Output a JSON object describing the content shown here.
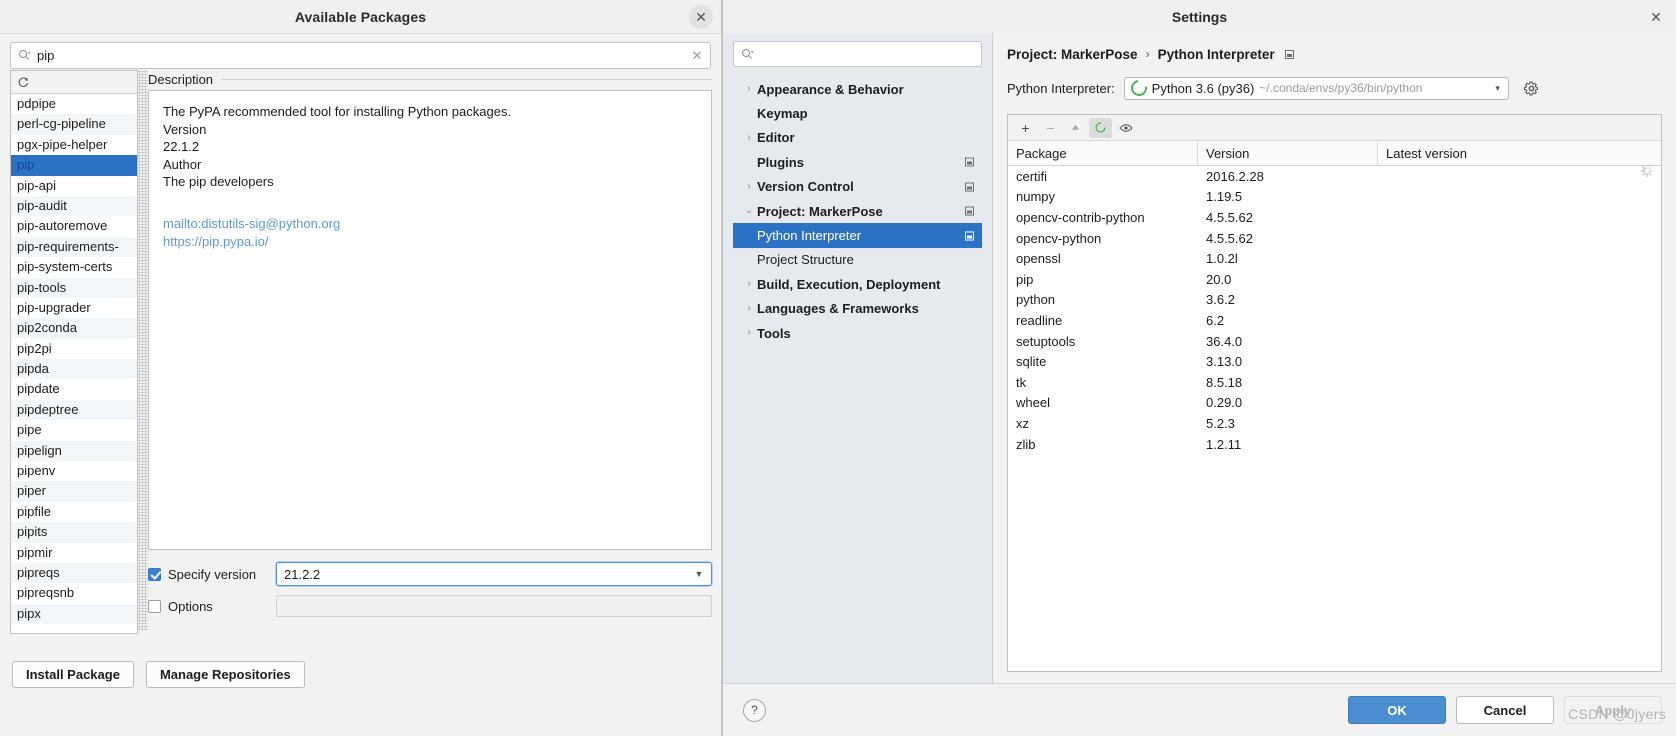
{
  "available_packages": {
    "title": "Available Packages",
    "close_label": "✕",
    "search": {
      "value": "pip",
      "placeholder": "",
      "clear_label": "✕"
    },
    "reload_icon": "refresh-icon",
    "package_list": [
      "pdpipe",
      "perl-cg-pipeline",
      "pgx-pipe-helper",
      "pip",
      "pip-api",
      "pip-audit",
      "pip-autoremove",
      "pip-requirements-",
      "pip-system-certs",
      "pip-tools",
      "pip-upgrader",
      "pip2conda",
      "pip2pi",
      "pipda",
      "pipdate",
      "pipdeptree",
      "pipe",
      "pipelign",
      "pipenv",
      "piper",
      "pipfile",
      "pipits",
      "pipmir",
      "pipreqs",
      "pipreqsnb",
      "pipx"
    ],
    "selected_package": "pip",
    "description": {
      "header": "Description",
      "lines": [
        "The PyPA recommended tool for installing Python packages.",
        "Version",
        "22.1.2",
        "Author",
        "The pip developers"
      ],
      "links": [
        "mailto:distutils-sig@python.org",
        "https://pip.pypa.io/"
      ]
    },
    "options": {
      "specify_version_label": "Specify version",
      "specify_version_checked": true,
      "specify_version_value": "21.2.2",
      "options_label": "Options",
      "options_checked": false,
      "options_value": ""
    },
    "buttons": {
      "install": "Install Package",
      "manage_repositories": "Manage Repositories"
    }
  },
  "settings": {
    "title": "Settings",
    "close_label": "✕",
    "search": {
      "value": "",
      "placeholder": ""
    },
    "tree": [
      {
        "label": "Appearance & Behavior",
        "twisty": "collapsed",
        "level": 0,
        "badge": false,
        "selected": false
      },
      {
        "label": "Keymap",
        "twisty": "none",
        "level": 0,
        "badge": false,
        "selected": false
      },
      {
        "label": "Editor",
        "twisty": "collapsed",
        "level": 0,
        "badge": false,
        "selected": false
      },
      {
        "label": "Plugins",
        "twisty": "none",
        "level": 0,
        "badge": true,
        "selected": false
      },
      {
        "label": "Version Control",
        "twisty": "collapsed",
        "level": 0,
        "badge": true,
        "selected": false
      },
      {
        "label": "Project: MarkerPose",
        "twisty": "expanded",
        "level": 0,
        "badge": true,
        "selected": false
      },
      {
        "label": "Python Interpreter",
        "twisty": "none",
        "level": 1,
        "badge": true,
        "selected": true
      },
      {
        "label": "Project Structure",
        "twisty": "none",
        "level": 1,
        "badge": false,
        "selected": false
      },
      {
        "label": "Build, Execution, Deployment",
        "twisty": "collapsed",
        "level": 0,
        "badge": false,
        "selected": false
      },
      {
        "label": "Languages & Frameworks",
        "twisty": "collapsed",
        "level": 0,
        "badge": false,
        "selected": false
      },
      {
        "label": "Tools",
        "twisty": "collapsed",
        "level": 0,
        "badge": false,
        "selected": false
      }
    ],
    "breadcrumb": {
      "project": "Project: MarkerPose",
      "separator": "›",
      "page": "Python Interpreter"
    },
    "interpreter": {
      "label": "Python Interpreter:",
      "name": "Python 3.6 (py36)",
      "path": "~/.conda/envs/py36/bin/python",
      "arrow": "▾",
      "gear_icon": "gear-icon"
    },
    "package_toolbar": {
      "add": "+",
      "remove": "−",
      "upgrade": "▲",
      "conda_icon": "conda-refresh-icon",
      "show_early_releases_icon": "eye-icon"
    },
    "packages_table": {
      "columns": [
        "Package",
        "Version",
        "Latest version"
      ],
      "rows": [
        {
          "package": "certifi",
          "version": "2016.2.28",
          "latest": ""
        },
        {
          "package": "numpy",
          "version": "1.19.5",
          "latest": ""
        },
        {
          "package": "opencv-contrib-python",
          "version": "4.5.5.62",
          "latest": ""
        },
        {
          "package": "opencv-python",
          "version": "4.5.5.62",
          "latest": ""
        },
        {
          "package": "openssl",
          "version": "1.0.2l",
          "latest": ""
        },
        {
          "package": "pip",
          "version": "20.0",
          "latest": ""
        },
        {
          "package": "python",
          "version": "3.6.2",
          "latest": ""
        },
        {
          "package": "readline",
          "version": "6.2",
          "latest": ""
        },
        {
          "package": "setuptools",
          "version": "36.4.0",
          "latest": ""
        },
        {
          "package": "sqlite",
          "version": "3.13.0",
          "latest": ""
        },
        {
          "package": "tk",
          "version": "8.5.18",
          "latest": ""
        },
        {
          "package": "wheel",
          "version": "0.29.0",
          "latest": ""
        },
        {
          "package": "xz",
          "version": "5.2.3",
          "latest": ""
        },
        {
          "package": "zlib",
          "version": "1.2.11",
          "latest": ""
        }
      ]
    },
    "footer": {
      "help": "?",
      "ok": "OK",
      "cancel": "Cancel",
      "apply": "Apply"
    }
  },
  "watermark": "CSDN @Jjyers",
  "colors": {
    "selection_blue": "#2c72c4",
    "primary_button": "#4a8ed0",
    "link": "#5f9ad6",
    "tree_panel": "#e6eaee"
  }
}
